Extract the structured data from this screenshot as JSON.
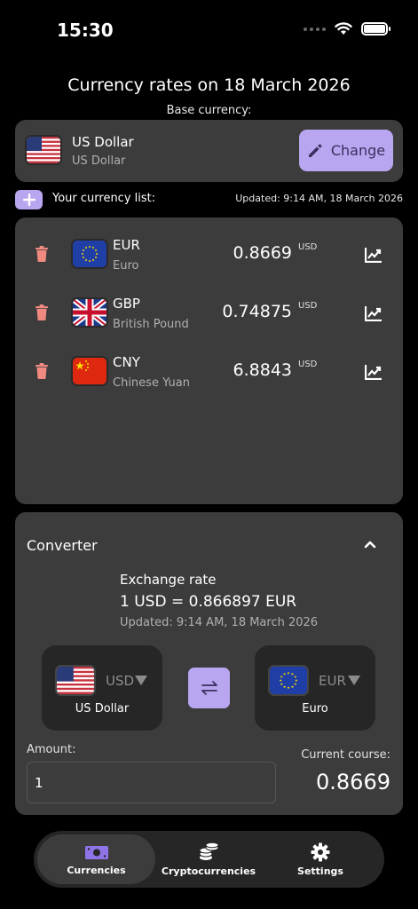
{
  "status_bar": {
    "time": "15:30"
  },
  "header": {
    "title": "Currency rates on 18 March 2026",
    "base_label": "Base currency:"
  },
  "base_currency": {
    "code": "US Dollar",
    "name": "US Dollar",
    "flag": "us-flag",
    "change_label": "Change"
  },
  "currency_list": {
    "label": "Your currency list:",
    "updated": "Updated: 9:14 AM, 18 March 2026",
    "items": [
      {
        "code": "EUR",
        "name": "Euro",
        "rate": "0.8669",
        "unit": "USD",
        "flag": "eu-flag"
      },
      {
        "code": "GBP",
        "name": "British Pound",
        "rate": "0.74875",
        "unit": "USD",
        "flag": "uk-flag"
      },
      {
        "code": "CNY",
        "name": "Chinese Yuan",
        "rate": "6.8843",
        "unit": "USD",
        "flag": "cn-flag"
      }
    ]
  },
  "converter": {
    "title": "Converter",
    "exchange_label": "Exchange rate",
    "exchange_value": "1 USD = 0.866897 EUR",
    "updated": "Updated: 9:14 AM, 18 March 2026",
    "from": {
      "code": "USD",
      "name": "US Dollar",
      "flag": "us-flag"
    },
    "to": {
      "code": "EUR",
      "name": "Euro",
      "flag": "eu-flag"
    },
    "amount_label": "Amount:",
    "amount_value": "1",
    "course_label": "Current course:",
    "course_value": "0.8669"
  },
  "tabs": [
    {
      "label": "Currencies",
      "icon": "banknote-icon",
      "active": true
    },
    {
      "label": "Cryptocurrencies",
      "icon": "coins-stack-icon",
      "active": false
    },
    {
      "label": "Settings",
      "icon": "gear-icon",
      "active": false
    }
  ],
  "colors": {
    "accent": "#b9a6f0",
    "card": "#3c3c3c",
    "background": "#000000",
    "trash": "#f08a80"
  }
}
